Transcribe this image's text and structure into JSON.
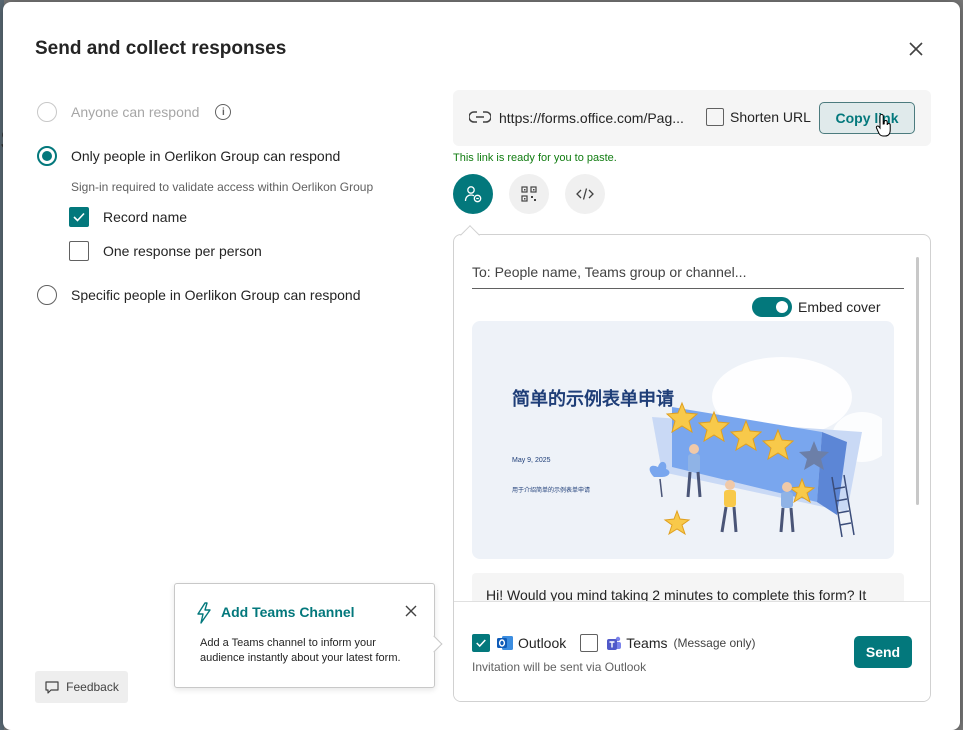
{
  "dialog": {
    "title": "Send and collect responses",
    "close_icon": "close-icon"
  },
  "permissions": {
    "options": [
      {
        "label": "Anyone can respond",
        "state": "disabled"
      },
      {
        "label": "Only people in Oerlikon Group can respond",
        "state": "checked"
      },
      {
        "label": "Specific people in Oerlikon Group can respond",
        "state": "unchecked"
      }
    ],
    "signin_note": "Sign-in required to validate access within Oerlikon Group",
    "record_name": {
      "label": "Record name",
      "checked": true
    },
    "one_response": {
      "label": "One response per person",
      "checked": false
    }
  },
  "link": {
    "url": "https://forms.office.com/Pag...",
    "shorten_label": "Shorten URL",
    "shorten_checked": false,
    "copy_label": "Copy link",
    "ready_note": "This link is ready for you to paste."
  },
  "share_methods": [
    {
      "icon": "person-share-icon",
      "active": true
    },
    {
      "icon": "qr-code-icon",
      "active": false
    },
    {
      "icon": "embed-code-icon",
      "active": false
    }
  ],
  "share_panel": {
    "to_placeholder": "To: People name, Teams group or channel...",
    "embed_cover_label": "Embed cover",
    "embed_cover_on": true,
    "cover": {
      "title": "简单的示例表单申请",
      "date": "May 9, 2025",
      "subtitle": "用于介绍简单的示例表单申请"
    },
    "message": "Hi! Would you mind taking 2 minutes to complete this form? It",
    "outlook": {
      "label": "Outlook",
      "checked": true
    },
    "teams": {
      "label": "Teams",
      "note": "(Message only)",
      "checked": false
    },
    "invite_note": "Invitation will be sent via Outlook",
    "send_label": "Send"
  },
  "teams_callout": {
    "title": "Add Teams Channel",
    "body": "Add a Teams channel to inform your audience instantly about your latest form."
  },
  "feedback": {
    "label": "Feedback"
  },
  "colors": {
    "accent": "#03787c",
    "success": "#107c10"
  }
}
